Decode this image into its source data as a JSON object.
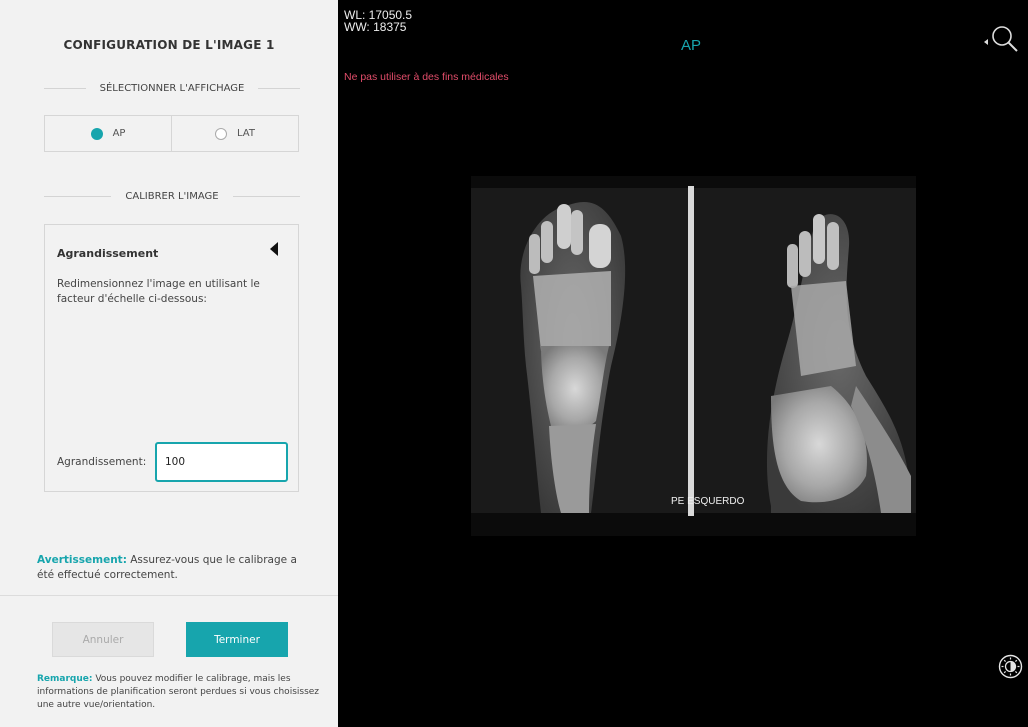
{
  "panel": {
    "title": "CONFIGURATION DE L'IMAGE 1",
    "select_display_heading": "SÉLECTIONNER L'AFFICHAGE",
    "view_options": [
      {
        "label": "AP",
        "selected": true
      },
      {
        "label": "LAT",
        "selected": false
      }
    ],
    "calibrate_heading": "CALIBRER L'IMAGE",
    "calibration": {
      "title": "Agrandissement",
      "description": "Redimensionnez l'image en utilisant le facteur d'échelle ci-dessous:",
      "field_label": "Agrandissement:",
      "field_value": "100"
    },
    "warning_label": "Avertissement:",
    "warning_text": " Assurez-vous que le calibrage a été effectué correctement.",
    "cancel_label": "Annuler",
    "done_label": "Terminer",
    "remark_label": "Remarque:",
    "remark_text": " Vous pouvez modifier le calibrage, mais les informations de planification seront perdues si vous choisissez une autre vue/orientation."
  },
  "viewer": {
    "window_level": "WL: 17050.5",
    "window_width": "WW: 18375",
    "view_label": "AP",
    "disclaimer": "Ne pas utiliser à des fins médicales",
    "xray_caption": "PE ESQUERDO",
    "icons": [
      "zoom-icon",
      "brightness-contrast-icon"
    ]
  },
  "colors": {
    "accent": "#17a5ad",
    "disclaimer": "#e24d6a",
    "panel_bg": "#f2f2f2",
    "viewer_bg": "#000000"
  }
}
